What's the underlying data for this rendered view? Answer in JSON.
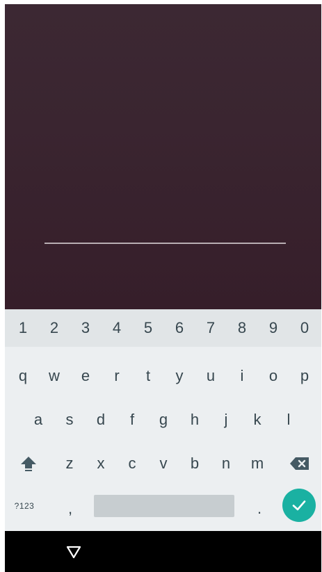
{
  "keyboard": {
    "number_row": [
      "1",
      "2",
      "3",
      "4",
      "5",
      "6",
      "7",
      "8",
      "9",
      "0"
    ],
    "row1": [
      "q",
      "w",
      "e",
      "r",
      "t",
      "y",
      "u",
      "i",
      "o",
      "p"
    ],
    "row2": [
      "a",
      "s",
      "d",
      "f",
      "g",
      "h",
      "j",
      "k",
      "l"
    ],
    "row3": [
      "z",
      "x",
      "c",
      "v",
      "b",
      "n",
      "m"
    ],
    "symbols_label": "?123",
    "comma_label": ",",
    "period_label": "."
  },
  "colors": {
    "background": "#3a2530",
    "pin_underline": "#b9aeb3",
    "keyboard_bg": "#eceff1",
    "number_row_bg": "#e1e5e7",
    "key_text": "#37474f",
    "enter_accent": "#1ab1a2",
    "navbar": "#000000"
  },
  "icons": {
    "shift": "shift-icon",
    "backspace": "backspace-icon",
    "enter": "checkmark-icon",
    "back": "back-triangle-icon"
  }
}
